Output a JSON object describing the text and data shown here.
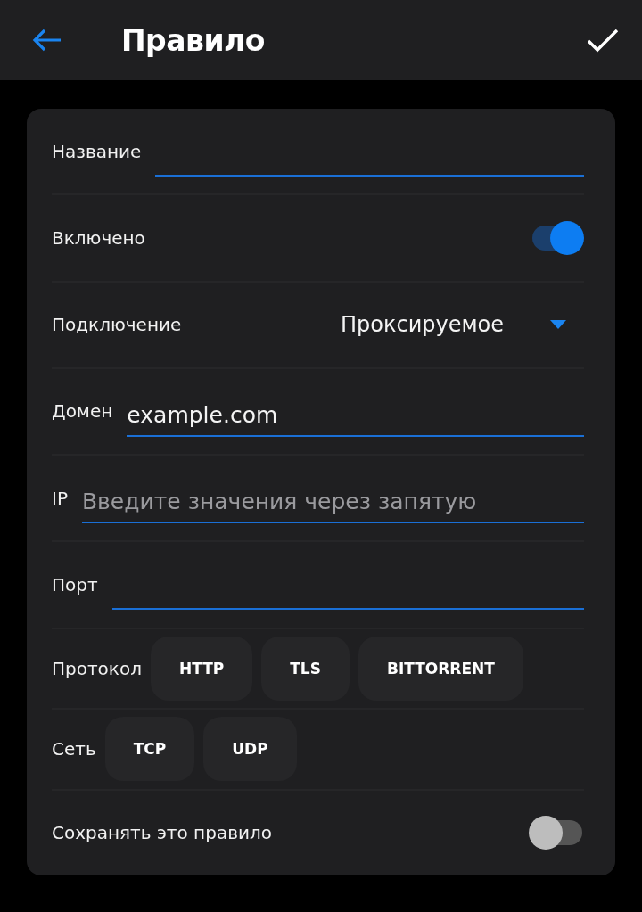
{
  "header": {
    "title": "Правило"
  },
  "rows": [
    {
      "kind": "text",
      "label": "Название"
    },
    {
      "kind": "toggle",
      "label": "Включено",
      "on": true
    },
    {
      "kind": "dropdown",
      "label": "Подключение",
      "value": "Проксируемое"
    },
    {
      "kind": "text",
      "label": "Домен",
      "value": "example.com"
    },
    {
      "kind": "text",
      "label": "IP",
      "placeholder": "Введите значения через запятую"
    },
    {
      "kind": "text",
      "label": "Порт"
    },
    {
      "kind": "chips",
      "label": "Протокол",
      "chips": [
        {
          "label": "HTTP",
          "selected": false
        },
        {
          "label": "TLS",
          "selected": false
        },
        {
          "label": "BITTORRENT",
          "selected": false
        }
      ]
    },
    {
      "kind": "chips",
      "label": "Сеть",
      "chips": [
        {
          "label": "TCP",
          "selected": false
        },
        {
          "label": "UDP",
          "selected": false
        }
      ]
    },
    {
      "kind": "toggle",
      "label": "Сохранять это правило",
      "on": false
    }
  ]
}
